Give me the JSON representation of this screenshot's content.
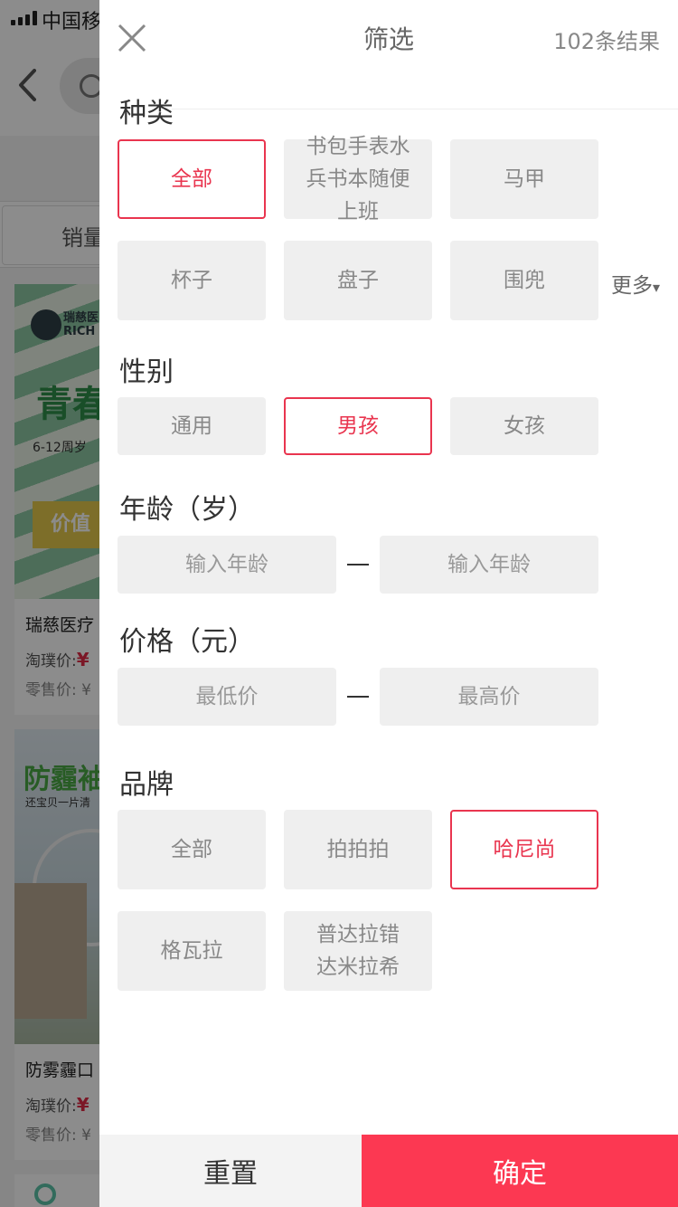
{
  "status_bar": {
    "carrier": "中国移"
  },
  "background": {
    "sort_tab": "销量",
    "cards": [
      {
        "brand_mini": "瑞慈医\nRICH",
        "promo_text": "青春",
        "age_tag": "6-12周岁",
        "ribbon": "价值",
        "title": "瑞慈医疗",
        "price_label": "淘璞价:",
        "price_value": "¥",
        "retail_label": "零售价: ¥"
      },
      {
        "headline": "防霾袖",
        "subline": "还宝贝一片清",
        "title": "防雾霾口",
        "price_label": "淘璞价:",
        "price_value": "¥",
        "retail_label": "零售价: ¥"
      }
    ]
  },
  "filter": {
    "title": "筛选",
    "result_count": "102条结果",
    "more_label": "更多",
    "more_arrow": "▾",
    "category": {
      "title": "种类",
      "chips": [
        {
          "label": "全部",
          "selected": true
        },
        {
          "label": "书包手表水兵书本随便上班",
          "selected": false
        },
        {
          "label": "马甲",
          "selected": false
        },
        {
          "label": "杯子",
          "selected": false
        },
        {
          "label": "盘子",
          "selected": false
        },
        {
          "label": "围兜",
          "selected": false
        }
      ]
    },
    "gender": {
      "title": "性别",
      "chips": [
        {
          "label": "通用",
          "selected": false
        },
        {
          "label": "男孩",
          "selected": true
        },
        {
          "label": "女孩",
          "selected": false
        }
      ]
    },
    "age": {
      "title": "年龄（岁）",
      "min_placeholder": "输入年龄",
      "max_placeholder": "输入年龄",
      "min_value": "",
      "max_value": ""
    },
    "price": {
      "title": "价格（元）",
      "min_placeholder": "最低价",
      "max_placeholder": "最高价",
      "min_value": "",
      "max_value": ""
    },
    "brand": {
      "title": "品牌",
      "chips": [
        {
          "label": "全部",
          "selected": false
        },
        {
          "label": "拍拍拍",
          "selected": false
        },
        {
          "label": "哈尼尚",
          "selected": true
        },
        {
          "label": "格瓦拉",
          "selected": false
        },
        {
          "label": "普达拉错达米拉希",
          "selected": false
        }
      ]
    },
    "reset_label": "重置",
    "confirm_label": "确定"
  },
  "colors": {
    "accent": "#fc3852",
    "selected_border": "#e9354f",
    "chip_bg": "#efefef",
    "overlay": "rgba(0,0,0,0.45)"
  },
  "icons": {
    "close": "close-icon",
    "back": "back-arrow-icon",
    "search": "search-icon",
    "more": "chevron-down-icon"
  }
}
